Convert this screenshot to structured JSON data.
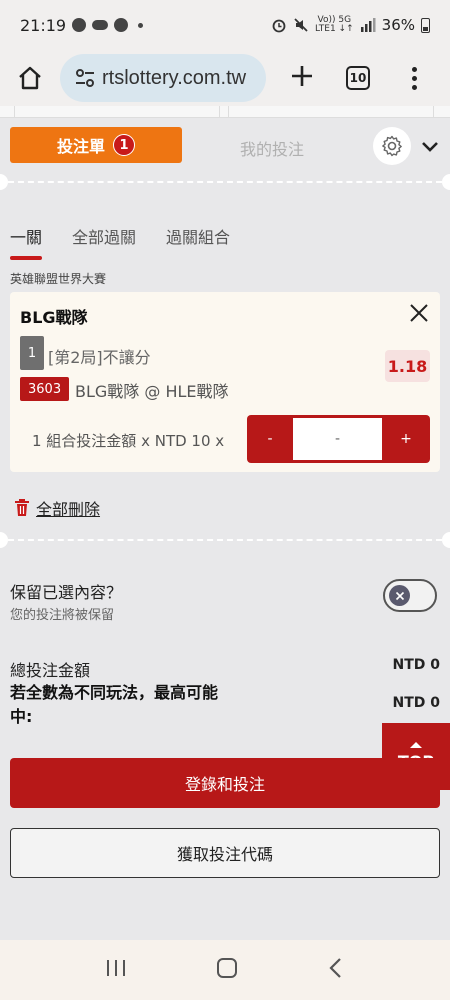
{
  "status_bar": {
    "time": "21:19",
    "battery": "36%",
    "network_top": "Vo)) 5G",
    "network_bottom": "LTE1 ↓↑"
  },
  "browser": {
    "url": "rtslottery.com.tw",
    "tab_count": "10"
  },
  "slip": {
    "tab_betslip": "投注單",
    "tab_betslip_count": "1",
    "tab_mybets": "我的投注"
  },
  "sub_tabs": [
    "一關",
    "全部過關",
    "過關組合"
  ],
  "league": "英雄聯盟世界大賽",
  "bet": {
    "team": "BLG戰隊",
    "market_number": "1",
    "market": "[第2局]不讓分",
    "odds": "1.18",
    "match_code": "3603",
    "match": "BLG戰隊 @ HLE戰隊",
    "stake_label": "1 組合投注金額 x NTD 10 x",
    "stepper_minus": "-",
    "stepper_value": "-",
    "stepper_plus": "+"
  },
  "delete_all": "全部刪除",
  "keep": {
    "title": "保留已選內容？",
    "subtitle": "您的投注將被保留"
  },
  "totals": {
    "total_label": "總投注金額",
    "total_value": "NTD 0",
    "max_label": "若全數為不同玩法，最高可能中:",
    "max_value": "NTD 0"
  },
  "top_button": "TOP",
  "login_button": "登錄和投注",
  "code_button": "獲取投注代碼",
  "icons": {
    "home": "home-icon",
    "site_settings": "tune-icon",
    "gear": "gear-icon",
    "chevron": "chevron-down-icon",
    "close": "close-icon",
    "trash": "trash-icon",
    "recents": "recents-icon",
    "home_nav": "home-nav-icon",
    "back": "back-icon"
  },
  "colors": {
    "accent_red": "#b71818",
    "orange": "#ee7512",
    "odds_bg": "#f6e1e0"
  }
}
